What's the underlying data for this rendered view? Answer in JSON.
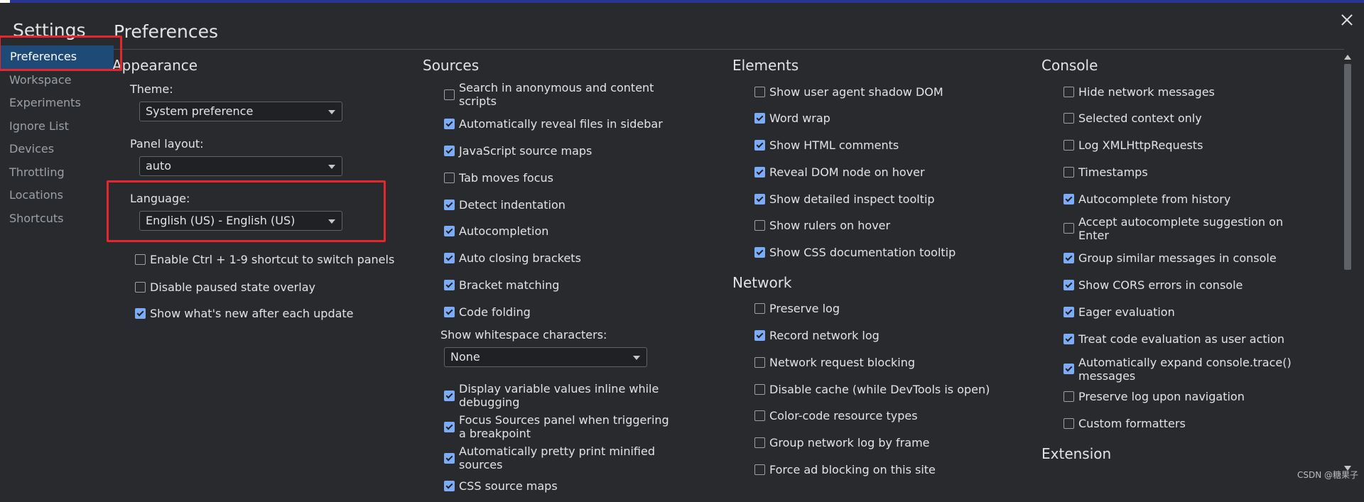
{
  "window": {
    "close_icon": "close-x-icon"
  },
  "sidebar": {
    "title": "Settings",
    "items": [
      {
        "label": "Preferences",
        "active": true
      },
      {
        "label": "Workspace"
      },
      {
        "label": "Experiments"
      },
      {
        "label": "Ignore List"
      },
      {
        "label": "Devices"
      },
      {
        "label": "Throttling"
      },
      {
        "label": "Locations"
      },
      {
        "label": "Shortcuts"
      }
    ]
  },
  "page": {
    "title": "Preferences"
  },
  "appearance": {
    "heading": "Appearance",
    "theme_label": "Theme:",
    "theme_value": "System preference",
    "panel_layout_label": "Panel layout:",
    "panel_layout_value": "auto",
    "language_label": "Language:",
    "language_value": "English (US) - English (US)",
    "options": [
      {
        "label": "Enable Ctrl + 1-9 shortcut to switch panels",
        "checked": false
      },
      {
        "label": "Disable paused state overlay",
        "checked": false
      },
      {
        "label": "Show what's new after each update",
        "checked": true
      }
    ]
  },
  "sources": {
    "heading": "Sources",
    "options_a": [
      {
        "label": "Search in anonymous and content scripts",
        "checked": false
      },
      {
        "label": "Automatically reveal files in sidebar",
        "checked": true
      },
      {
        "label": "JavaScript source maps",
        "checked": true
      },
      {
        "label": "Tab moves focus",
        "checked": false
      },
      {
        "label": "Detect indentation",
        "checked": true
      },
      {
        "label": "Autocompletion",
        "checked": true
      },
      {
        "label": "Auto closing brackets",
        "checked": true
      },
      {
        "label": "Bracket matching",
        "checked": true
      },
      {
        "label": "Code folding",
        "checked": true
      }
    ],
    "whitespace_label": "Show whitespace characters:",
    "whitespace_value": "None",
    "options_b": [
      {
        "label": "Display variable values inline while debugging",
        "checked": true
      },
      {
        "label": "Focus Sources panel when triggering a breakpoint",
        "checked": true
      },
      {
        "label": "Automatically pretty print minified sources",
        "checked": true
      },
      {
        "label": "CSS source maps",
        "checked": true
      }
    ]
  },
  "elements": {
    "heading": "Elements",
    "options": [
      {
        "label": "Show user agent shadow DOM",
        "checked": false
      },
      {
        "label": "Word wrap",
        "checked": true
      },
      {
        "label": "Show HTML comments",
        "checked": true
      },
      {
        "label": "Reveal DOM node on hover",
        "checked": true
      },
      {
        "label": "Show detailed inspect tooltip",
        "checked": true
      },
      {
        "label": "Show rulers on hover",
        "checked": false
      },
      {
        "label": "Show CSS documentation tooltip",
        "checked": true
      }
    ]
  },
  "network": {
    "heading": "Network",
    "options": [
      {
        "label": "Preserve log",
        "checked": false
      },
      {
        "label": "Record network log",
        "checked": true
      },
      {
        "label": "Network request blocking",
        "checked": false
      },
      {
        "label": "Disable cache (while DevTools is open)",
        "checked": false
      },
      {
        "label": "Color-code resource types",
        "checked": false
      },
      {
        "label": "Group network log by frame",
        "checked": false
      },
      {
        "label": "Force ad blocking on this site",
        "checked": false
      }
    ]
  },
  "console": {
    "heading": "Console",
    "options": [
      {
        "label": "Hide network messages",
        "checked": false
      },
      {
        "label": "Selected context only",
        "checked": false
      },
      {
        "label": "Log XMLHttpRequests",
        "checked": false
      },
      {
        "label": "Timestamps",
        "checked": false
      },
      {
        "label": "Autocomplete from history",
        "checked": true
      },
      {
        "label": "Accept autocomplete suggestion on Enter",
        "checked": false
      },
      {
        "label": "Group similar messages in console",
        "checked": true
      },
      {
        "label": "Show CORS errors in console",
        "checked": true
      },
      {
        "label": "Eager evaluation",
        "checked": true
      },
      {
        "label": "Treat code evaluation as user action",
        "checked": true
      },
      {
        "label": "Automatically expand console.trace() messages",
        "checked": true
      },
      {
        "label": "Preserve log upon navigation",
        "checked": false
      },
      {
        "label": "Custom formatters",
        "checked": false
      }
    ]
  },
  "extension": {
    "heading": "Extension"
  },
  "watermark": "CSDN @糖果子",
  "colors": {
    "accent": "#7cacf8",
    "highlight_border": "#e6262d",
    "active_sidebar": "#1e4a77"
  }
}
